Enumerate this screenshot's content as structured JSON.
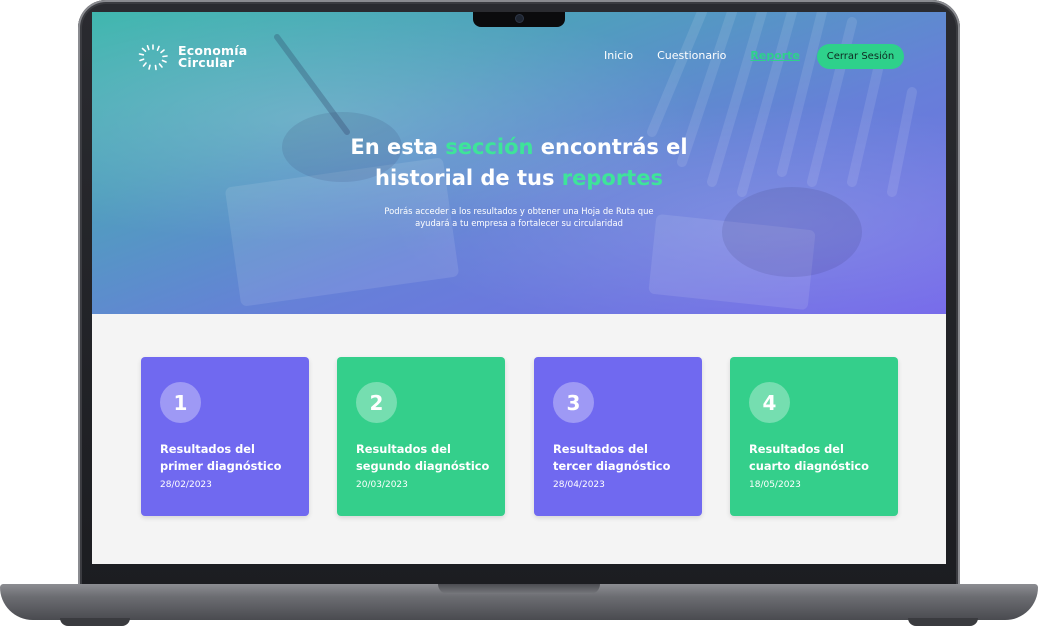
{
  "brand": {
    "line1": "Economía",
    "line2": "Circular"
  },
  "nav": {
    "items": [
      {
        "label": "Inicio",
        "active": false
      },
      {
        "label": "Cuestionario",
        "active": false
      },
      {
        "label": "Reporte",
        "active": true
      }
    ],
    "logout_label": "Cerrar Sesión"
  },
  "hero": {
    "title_1": "En esta ",
    "title_hl_1": "sección",
    "title_2": " encontrás el",
    "title_3": "historial de tus ",
    "title_hl_2": "reportes",
    "subtitle_line1": "Podrás acceder a los resultados y obtener una Hoja de Ruta que",
    "subtitle_line2": "ayudará a tu empresa a fortalecer su circularidad"
  },
  "reports": [
    {
      "number": "1",
      "title_line1": "Resultados del",
      "title_line2": "primer diagnóstico",
      "date": "28/02/2023",
      "color": "#7069f0"
    },
    {
      "number": "2",
      "title_line1": "Resultados del",
      "title_line2": "segundo diagnóstico",
      "date": "20/03/2023",
      "color": "#34cf8b"
    },
    {
      "number": "3",
      "title_line1": "Resultados del",
      "title_line2": "tercer diagnóstico",
      "date": "28/04/2023",
      "color": "#7069f0"
    },
    {
      "number": "4",
      "title_line1": "Resultados del",
      "title_line2": "cuarto diagnóstico",
      "date": "18/05/2023",
      "color": "#34cf8b"
    }
  ],
  "colors": {
    "accent_green": "#2ed18b",
    "purple": "#7069f0",
    "green": "#34cf8b"
  }
}
